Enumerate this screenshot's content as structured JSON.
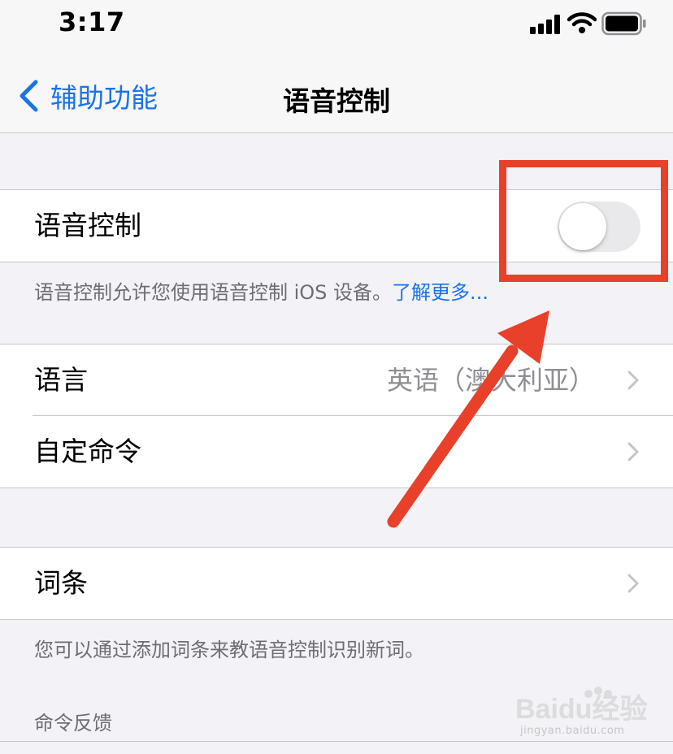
{
  "status_bar": {
    "time": "3:17",
    "icons": [
      "signal-icon",
      "wifi-icon",
      "battery-icon"
    ]
  },
  "nav": {
    "back_label": "辅助功能",
    "title": "语音控制"
  },
  "voice_control_group": {
    "label": "语音控制",
    "toggle_on": false
  },
  "voice_control_footnote": {
    "text": "语音控制允许您使用语音控制 iOS 设备。",
    "link": "了解更多..."
  },
  "settings_group": {
    "items": [
      {
        "label": "语言",
        "value": "英语（澳大利亚）"
      },
      {
        "label": "自定命令",
        "value": ""
      }
    ]
  },
  "vocabulary_group": {
    "label": "词条",
    "footnote": "您可以通过添加词条来教语音控制识别新词。"
  },
  "command_feedback": {
    "header": "命令反馈"
  },
  "watermark": {
    "text": "jingyan.baidu.com",
    "logo": "Baidu经验"
  },
  "colors": {
    "accent": "#1a73e8",
    "annotation": "#e8402a",
    "background": "#f2f2f7",
    "toggle_off": "#e9e9eb"
  }
}
